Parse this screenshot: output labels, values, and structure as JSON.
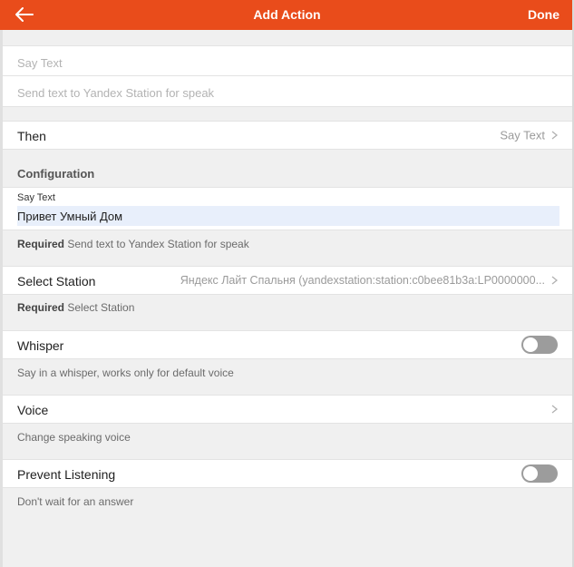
{
  "header": {
    "title": "Add Action",
    "done_label": "Done"
  },
  "intro": {
    "name_placeholder": "Say Text",
    "description_placeholder": "Send text to Yandex Station for speak"
  },
  "then_row": {
    "label": "Then",
    "value": "Say Text"
  },
  "configuration": {
    "section_title": "Configuration"
  },
  "say_text": {
    "field_label": "Say Text",
    "value": "Привет  Умный Дом",
    "required_label": "Required",
    "hint": "Send text to Yandex Station for speak"
  },
  "select_station": {
    "label": "Select Station",
    "value": "Яндекс Лайт Спальня (yandexstation:station:c0bee81b3a:LP0000000...",
    "required_label": "Required",
    "hint": "Select Station"
  },
  "whisper": {
    "label": "Whisper",
    "hint": "Say in a whisper, works only for default voice",
    "enabled": false
  },
  "voice": {
    "label": "Voice",
    "hint": "Change speaking voice"
  },
  "prevent_listening": {
    "label": "Prevent Listening",
    "hint": "Don't wait for an answer",
    "enabled": false
  },
  "colors": {
    "accent": "#e94c1b",
    "toggle_off": "#9c9c9c",
    "field_bg": "#e8effb"
  }
}
